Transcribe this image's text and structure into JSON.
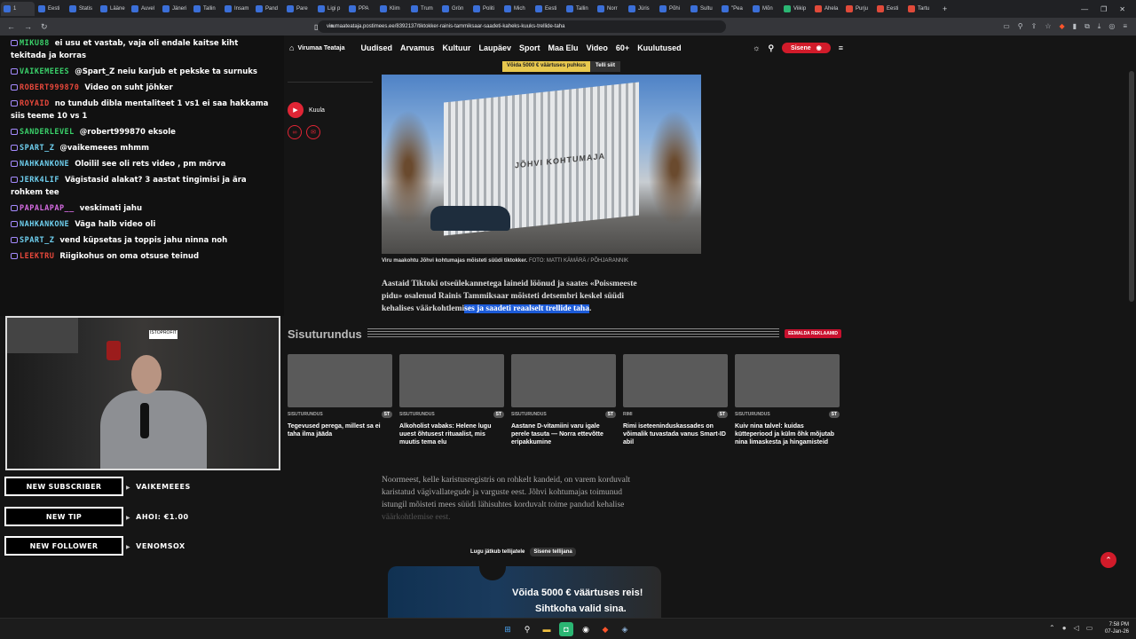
{
  "browser": {
    "tabs": [
      {
        "label": "1",
        "fav": "b",
        "active": true
      },
      {
        "label": "Eesti",
        "fav": "b"
      },
      {
        "label": "Statis",
        "fav": "b"
      },
      {
        "label": "Lääne",
        "fav": "b"
      },
      {
        "label": "Auvel",
        "fav": "b"
      },
      {
        "label": "Jäneri",
        "fav": "b"
      },
      {
        "label": "Tallin",
        "fav": "b"
      },
      {
        "label": "Insam",
        "fav": "b"
      },
      {
        "label": "Pand",
        "fav": "b"
      },
      {
        "label": "Pare",
        "fav": "b"
      },
      {
        "label": "Ligi p",
        "fav": "b"
      },
      {
        "label": "PPA",
        "fav": "b"
      },
      {
        "label": "Klim",
        "fav": "b"
      },
      {
        "label": "Trum",
        "fav": "b"
      },
      {
        "label": "Grön",
        "fav": "b"
      },
      {
        "label": "Politi",
        "fav": "b"
      },
      {
        "label": "Mich",
        "fav": "b"
      },
      {
        "label": "Eesti",
        "fav": "b"
      },
      {
        "label": "Tallin",
        "fav": "b"
      },
      {
        "label": "Norr",
        "fav": "b"
      },
      {
        "label": "Jüris",
        "fav": "b"
      },
      {
        "label": "Põhi",
        "fav": "b"
      },
      {
        "label": "Sultu",
        "fav": "b"
      },
      {
        "label": "\"Pea",
        "fav": "b"
      },
      {
        "label": "Mõn",
        "fav": "b"
      },
      {
        "label": "Viikip",
        "fav": "v"
      },
      {
        "label": "Ahela",
        "fav": "r"
      },
      {
        "label": "Purju",
        "fav": "r"
      },
      {
        "label": "Eesti",
        "fav": "r"
      },
      {
        "label": "Tartu",
        "fav": "r"
      }
    ],
    "new_tab": "+",
    "url": "virumaateataja.postimees.ee/8392137/tiktokker-rainis-tammiksaar-saadeti-kaheks-kuuks-trellide-taha"
  },
  "chat": [
    {
      "user": "MIKU88",
      "color": "#3ad16a",
      "text": "ei usu et vastab, vaja oli endale kaitse kiht tekitada ja korras"
    },
    {
      "user": "VAIKEMEEES",
      "color": "#3ad16a",
      "text": "@Spart_Z neiu karjub et pekske ta surnuks"
    },
    {
      "user": "ROBERT999870",
      "color": "#e8483b",
      "text": "Video on suht jõhker"
    },
    {
      "user": "ROYAID",
      "color": "#e8483b",
      "text": "no tundub dibla mentaliteet 1 vs1 ei saa hakkama siis teeme 10 vs 1"
    },
    {
      "user": "SANDERLEVEL",
      "color": "#3ad16a",
      "text": "@robert999870 eksole"
    },
    {
      "user": "SPART_Z",
      "color": "#6fd0f0",
      "text": "@vaikemeees mhmm"
    },
    {
      "user": "NAHKANKONE",
      "color": "#6fd0f0",
      "text": "Oloilil see oli rets video , pm mõrva"
    },
    {
      "user": "JERK4LIF",
      "color": "#6fd0f0",
      "text": "Vägistasid alakat? 3 aastat tingimisi ja ära rohkem tee"
    },
    {
      "user": "PAPALAPAP__",
      "color": "#d46be0",
      "text": "veskimati jahu"
    },
    {
      "user": "NAHKANKONE",
      "color": "#6fd0f0",
      "text": "Väga halb video oli"
    },
    {
      "user": "SPART_Z",
      "color": "#6fd0f0",
      "text": "vend küpsetas ja toppis jahu ninna noh"
    },
    {
      "user": "LEEKTRU",
      "color": "#e8483b",
      "text": "Riigikohus on oma otsuse teinud"
    }
  ],
  "webcam": {
    "sign": "ISTOPROFIT"
  },
  "alerts": [
    {
      "label": "NEW SUBSCRIBER",
      "value": "VAIKEMEEES"
    },
    {
      "label": "NEW TIP",
      "value": "AHOI: €1.00"
    },
    {
      "label": "NEW FOLLOWER",
      "value": "VENOMSOX"
    }
  ],
  "site": {
    "logo": "Virumaa Teataja",
    "nav": [
      "Uudised",
      "Arvamus",
      "Kultuur",
      "Laupäev",
      "Sport",
      "Maa Elu",
      "Video",
      "60+",
      "Kuulutused"
    ],
    "login": "Sisene",
    "promo_text": "Võida 5000 € väärtuses puhkus",
    "promo_btn": "Telli siit",
    "listen": "Kuula",
    "photo_sign": "JÕHVI KOHTUMAJA",
    "caption": "Viru maakohtu Jõhvi kohtumajas mõisteti süüdi tiktokker.",
    "caption_credit": "FOTO: MATTI KÄMÄRÄ / PÕHJARANNIK",
    "lead_a": "Aastaid Tiktoki otseülekannetega laineid löönud ja saates «Poissmeeste pidu» osalenud Rainis Tammiksaar mõisteti detsembri keskel süüdi kehalises väärkohtlemi",
    "lead_hl": "ses ja saadeti reaalselt trellide taha",
    "lead_end": ".",
    "sisu_title": "Sisuturundus",
    "sisu_remove": "EEMALDA REKLAAMID",
    "cards": [
      {
        "tag": "SISUTURUNDUS",
        "st": "ST",
        "title": "Tegevused perega, millest sa ei taha ilma jääda"
      },
      {
        "tag": "SISUTURUNDUS",
        "st": "ST",
        "title": "Alkoholist vabaks: Helene lugu uuest õhtusest rituaalist, mis muutis tema elu"
      },
      {
        "tag": "SISUTURUNDUS",
        "st": "ST",
        "title": "Aastane D-vitamiini varu igale perele tasuta — Norra ettevõtte eripakkumine"
      },
      {
        "tag": "RIMI",
        "st": "ST",
        "title": "Rimi iseteeninduskassades on võimalik tuvastada vanus Smart-ID abil"
      },
      {
        "tag": "SISUTURUNDUS",
        "st": "ST",
        "title": "Kuiv nina talvel: kuidas kütteperiood ja külm õhk mõjutab nina limaskesta ja hingamisteid"
      }
    ],
    "body": "Noormeest, kelle karistusregistris on rohkelt kandeid, on varem korduvalt karistatud vägivallategude ja varguste eest. Jõhvi kohtumajas toimunud istungil mõisteti mees süüdi lähisuhtes korduvalt toime pandud kehalise",
    "body_fade": "väärkohtlemise eest.",
    "paywall_text": "Lugu jätkub tellijatele",
    "paywall_btn": "Sisene tellijana",
    "promo_box_1": "Võida 5000 € väärtuses reis!",
    "promo_box_2": "Sihtkoha valid sina."
  },
  "taskbar": {
    "time": "7:58 PM",
    "date": "07-Jan-26"
  },
  "colors": {
    "brand_red": "#d11b2a",
    "highlight": "#1c5bd8"
  }
}
